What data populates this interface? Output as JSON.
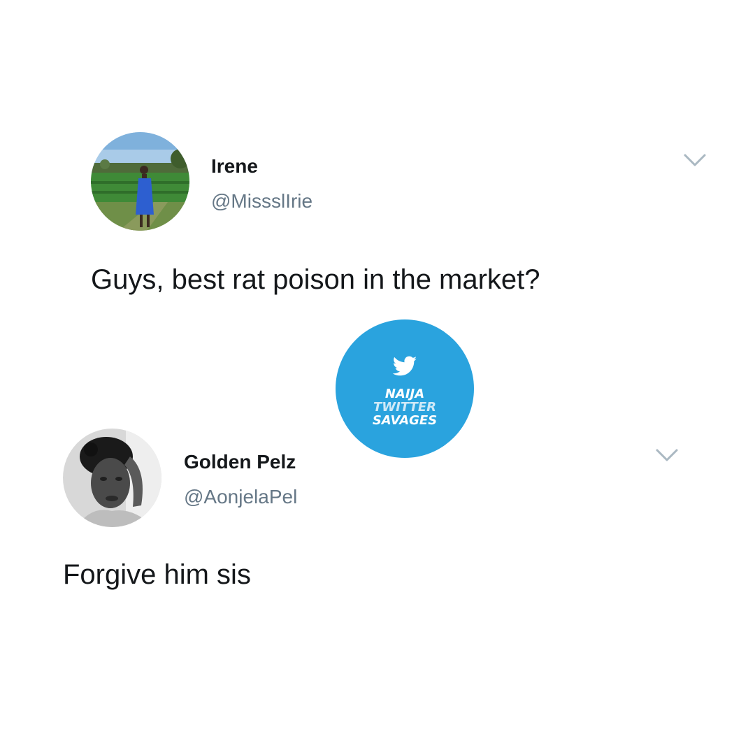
{
  "tweets": [
    {
      "display_name": "Irene",
      "handle": "@MissslIrie",
      "text": "Guys, best rat poison in the market?",
      "avatar": "profile-photo-woman-in-field"
    },
    {
      "display_name": "Golden Pelz",
      "handle": "@AonjelaPel",
      "text": "Forgive him sis",
      "avatar": "profile-photo-woman-grayscale"
    }
  ],
  "watermark": {
    "lines": [
      "NAIJA",
      "TWITTER",
      "SAVAGES"
    ],
    "icon": "twitter-bird-icon",
    "color": "#2aa3de"
  },
  "icons": {
    "more_options": "chevron-down-icon"
  },
  "colors": {
    "text_primary": "#14171a",
    "text_secondary": "#657786",
    "chevron": "#aab8c2"
  }
}
